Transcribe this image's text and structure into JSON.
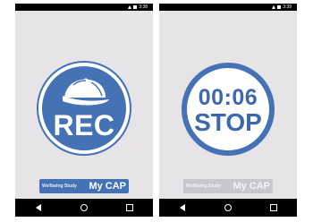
{
  "screens": [
    {
      "status_time": "3:38",
      "main_button_label": "REC",
      "brand_left": "Wellbeing Study",
      "brand_right": "My CAP"
    },
    {
      "status_time": "3:39",
      "timer": "00:06",
      "main_button_label": "STOP",
      "brand_left": "Wellbeing Study",
      "brand_right": "My CAP"
    }
  ],
  "icons": {
    "main_icon": "cap-icon",
    "nav": [
      "back-icon",
      "home-icon",
      "recent-apps-icon"
    ],
    "status": [
      "signal-icon",
      "battery-icon"
    ]
  },
  "colors": {
    "accent": "#4472b4",
    "screen_bg": "#e6e4e7",
    "bar_bg": "#000000",
    "inactive_logo": "#c9c7cb"
  }
}
